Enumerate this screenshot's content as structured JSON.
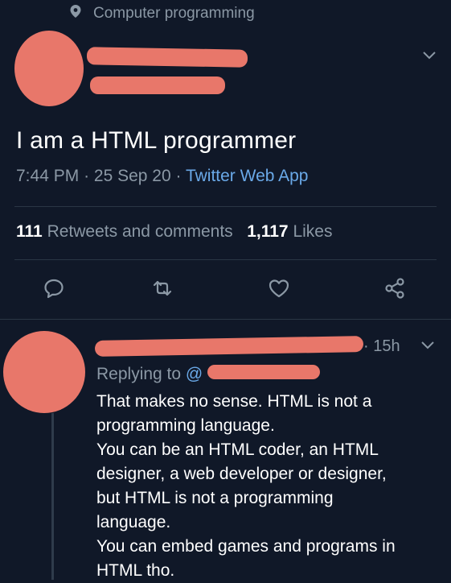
{
  "topic": {
    "label": "Computer programming",
    "icon": "topic-pin-icon"
  },
  "tweet": {
    "text": "I am a HTML programmer",
    "time": "7:44 PM",
    "date": "25 Sep 20",
    "source": "Twitter Web App",
    "retweets_count": "111",
    "retweets_label": "Retweets and comments",
    "likes_count": "1,117",
    "likes_label": "Likes"
  },
  "reply": {
    "time": "15h",
    "replying_label": "Replying to",
    "replying_prefix": "@",
    "lines": [
      "That makes no sense. HTML is not a",
      "programming language.",
      "You can be an HTML coder, an HTML",
      "designer, a web developer or designer,",
      "but HTML is not a programming",
      "language.",
      "You can embed games and programs in",
      "HTML tho."
    ]
  },
  "colors": {
    "background": "#101828",
    "muted": "#8b98a5",
    "link": "#6aa9e8",
    "redaction": "#e8776a"
  }
}
